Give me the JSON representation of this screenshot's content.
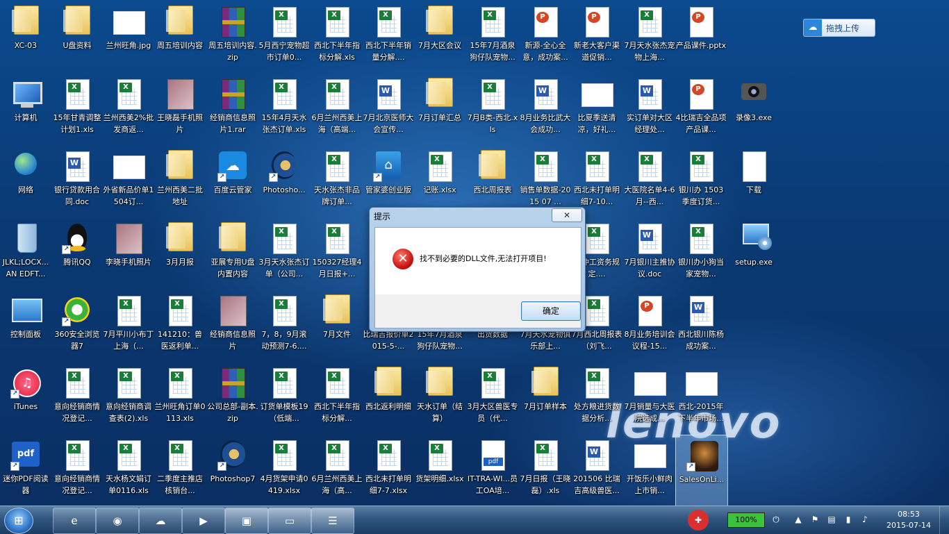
{
  "desktop": {
    "brand_text": "lenovo",
    "icons": [
      {
        "label": "XC-03",
        "icon": "user-folder-icon"
      },
      {
        "label": "U盘资料",
        "icon": "folder-icon"
      },
      {
        "label": "兰州旺角.jpg",
        "icon": "image-file-icon"
      },
      {
        "label": "周五培训内容",
        "icon": "folder-icon"
      },
      {
        "label": "周五培训内容.zip",
        "icon": "rar-archive-icon"
      },
      {
        "label": "5月西宁宠物超市订单0...",
        "icon": "excel-file-icon"
      },
      {
        "label": "西北下半年指标分解.xls",
        "icon": "excel-file-icon"
      },
      {
        "label": "西北下半年销量分解....",
        "icon": "excel-file-icon"
      },
      {
        "label": "7月大区会议",
        "icon": "folder-icon"
      },
      {
        "label": "15年7月酒泉狗仔队宠物...",
        "icon": "excel-file-icon"
      },
      {
        "label": "新源-全心全意，成功案...",
        "icon": "powerpoint-file-icon"
      },
      {
        "label": "新老大客户渠道促销...",
        "icon": "powerpoint-file-icon"
      },
      {
        "label": "7月天水张杰宠物上海...",
        "icon": "excel-file-icon"
      },
      {
        "label": "产品课件.pptx",
        "icon": "powerpoint-file-icon"
      },
      {
        "label": "计算机",
        "icon": "computer-icon"
      },
      {
        "label": "15年甘青调整计划1.xls",
        "icon": "excel-file-icon"
      },
      {
        "label": "兰州西美2%批发商返...",
        "icon": "excel-file-icon"
      },
      {
        "label": "王晓磊手机照片",
        "icon": "photo-folder-icon"
      },
      {
        "label": "经销商信息照片1.rar",
        "icon": "rar-archive-icon"
      },
      {
        "label": "15年4月天水张杰订单.xls",
        "icon": "excel-file-icon"
      },
      {
        "label": "6月兰州西美上海（高端...",
        "icon": "excel-file-icon"
      },
      {
        "label": "7月北京医师大会宣传...",
        "icon": "word-file-icon"
      },
      {
        "label": "7月订单汇总",
        "icon": "folder-icon"
      },
      {
        "label": "7月B类-西北.xls",
        "icon": "excel-file-icon"
      },
      {
        "label": "8月业务比武大会成功...",
        "icon": "word-file-icon"
      },
      {
        "label": "比夏季送清凉，好礼...",
        "icon": "image-file-icon"
      },
      {
        "label": "实订单对大区经理处...",
        "icon": "word-file-icon"
      },
      {
        "label": "4比瑞吉全品项产品课...",
        "icon": "powerpoint-file-icon"
      },
      {
        "label": "录像3.exe",
        "icon": "video-camera-icon"
      },
      {
        "label": "网络",
        "icon": "network-globe-icon"
      },
      {
        "label": "银行贷款用合同.doc",
        "icon": "word-file-icon"
      },
      {
        "label": "外省新品价单1504订...",
        "icon": "image-file-icon"
      },
      {
        "label": "兰州西美二批地址",
        "icon": "folder-icon"
      },
      {
        "label": "百度云管家",
        "icon": "baidu-cloud-icon"
      },
      {
        "label": "Photosho...",
        "icon": "photoshop-icon"
      },
      {
        "label": "天水张杰非品牌订单...",
        "icon": "excel-file-icon"
      },
      {
        "label": "管家婆创业版",
        "icon": "accounting-app-icon"
      },
      {
        "label": "记账.xlsx",
        "icon": "excel-file-icon"
      },
      {
        "label": "西北周报表",
        "icon": "folder-icon"
      },
      {
        "label": "销售单数据-2015 07 ...",
        "icon": "excel-file-icon"
      },
      {
        "label": "西北未打单明细7-10...",
        "icon": "excel-file-icon"
      },
      {
        "label": "大医院名单4-6月--西...",
        "icon": "excel-file-icon"
      },
      {
        "label": "银川办 1503季度订货...",
        "icon": "excel-file-icon"
      },
      {
        "label": "下载",
        "icon": "blank-file-icon"
      },
      {
        "label": "JLKL;LOCX...AN EDFT...",
        "icon": "recycle-bin-icon"
      },
      {
        "label": "腾讯QQ",
        "icon": "qq-penguin-icon"
      },
      {
        "label": "李晓手机照片",
        "icon": "photo-folder-icon"
      },
      {
        "label": "3月月报",
        "icon": "folder-icon"
      },
      {
        "label": "亚展专用U盘内置内容",
        "icon": "folder-icon"
      },
      {
        "label": "3月天水张杰订单（公司...",
        "icon": "excel-file-icon"
      },
      {
        "label": "150327经理4月日报+...",
        "icon": "excel-file-icon"
      },
      {
        "label": "用冲工资务规定....",
        "icon": "excel-file-icon"
      },
      {
        "label": "7月银川主推协议.doc",
        "icon": "word-file-icon"
      },
      {
        "label": "银川办小狗当家宠物...",
        "icon": "excel-file-icon"
      },
      {
        "label": "setup.exe",
        "icon": "setup-disc-icon"
      },
      {
        "label": "控制面板",
        "icon": "control-panel-icon"
      },
      {
        "label": "360安全浏览器7",
        "icon": "browser-360-icon"
      },
      {
        "label": "7月平川小布丁上海（...",
        "icon": "excel-file-icon"
      },
      {
        "label": "141210：兽医返利单...",
        "icon": "excel-file-icon"
      },
      {
        "label": "经销商信息照片",
        "icon": "photo-folder-icon"
      },
      {
        "label": "7，8，9月滚动预测7-6....",
        "icon": "excel-file-icon"
      },
      {
        "label": "7月文件",
        "icon": "folder-icon"
      },
      {
        "label": "比瑞吉报价单2015-5-...",
        "icon": "excel-file-icon"
      },
      {
        "label": "15年7月酒泉狗仔队宠物...",
        "icon": "excel-file-icon"
      },
      {
        "label": "出货数据",
        "icon": "excel-file-icon"
      },
      {
        "label": "7月天水宠物俱乐部上...",
        "icon": "excel-file-icon"
      },
      {
        "label": "7月西北周报表（刘飞...",
        "icon": "excel-file-icon"
      },
      {
        "label": "8月业务培训会议程-15...",
        "icon": "powerpoint-file-icon"
      },
      {
        "label": "西北银川陈杨成功案...",
        "icon": "word-file-icon"
      },
      {
        "label": "iTunes",
        "icon": "itunes-icon"
      },
      {
        "label": "意向经销商情况登记...",
        "icon": "excel-file-icon"
      },
      {
        "label": "意向经销商调查表(2).xls",
        "icon": "excel-file-icon"
      },
      {
        "label": "兰州旺角订单0113.xls",
        "icon": "excel-file-icon"
      },
      {
        "label": "公司总部-副本.zip",
        "icon": "rar-archive-icon"
      },
      {
        "label": "订货单模板19（低端...",
        "icon": "excel-file-icon"
      },
      {
        "label": "西北下半年指标分解...",
        "icon": "excel-file-icon"
      },
      {
        "label": "西北返利明细",
        "icon": "folder-icon"
      },
      {
        "label": "天水订单（结算）",
        "icon": "folder-icon"
      },
      {
        "label": "3月大区兽医专员（代...",
        "icon": "excel-file-icon"
      },
      {
        "label": "7月订单样本",
        "icon": "folder-icon"
      },
      {
        "label": "处方粮进货数据分析...",
        "icon": "excel-file-icon"
      },
      {
        "label": "7月销量与大医院选成...",
        "icon": "image-file-icon"
      },
      {
        "label": "西北-2015年下半年市场...",
        "icon": "image-file-icon"
      },
      {
        "label": "迷你PDF阅读器",
        "icon": "pdf-reader-icon"
      },
      {
        "label": "意向经销商情况登记...",
        "icon": "excel-file-icon"
      },
      {
        "label": "天水杨文娟订单0116.xls",
        "icon": "excel-file-icon"
      },
      {
        "label": "二季度主推店核销台...",
        "icon": "excel-file-icon"
      },
      {
        "label": "Photoshop7",
        "icon": "photoshop-icon"
      },
      {
        "label": "4月货架申请0419.xlsx",
        "icon": "excel-file-icon"
      },
      {
        "label": "6月兰州西美上海（高...",
        "icon": "excel-file-icon"
      },
      {
        "label": "西北未打单明细7-7.xlsx",
        "icon": "excel-file-icon"
      },
      {
        "label": "货架明细.xlsx",
        "icon": "excel-file-icon"
      },
      {
        "label": "IT-TRA-WI...员工OA培...",
        "icon": "pdf-file-icon"
      },
      {
        "label": "7月日报（王晓磊）.xls",
        "icon": "excel-file-icon"
      },
      {
        "label": "201506 比瑞吉高级兽医...",
        "icon": "word-file-icon"
      },
      {
        "label": "开饭乐小鲜肉上市销...",
        "icon": "image-file-icon"
      },
      {
        "label": "SalesOnLi...",
        "icon": "dog-app-icon"
      }
    ]
  },
  "upload_widget": {
    "label": "拖拽上传",
    "icon": "cloud-upload-icon"
  },
  "dialog": {
    "title": "提示",
    "close_label": "✕",
    "message": "找不到必要的DLL文件,无法打开项目!",
    "ok_label": "确定",
    "icon": "error-icon"
  },
  "taskbar": {
    "start_icon": "windows-start-icon",
    "pinned": [
      {
        "name": "ie-browser",
        "icon": "browser-360-icon"
      },
      {
        "name": "photoshop",
        "icon": "photoshop-icon"
      },
      {
        "name": "baidu-cloud",
        "icon": "baidu-cloud-icon"
      },
      {
        "name": "iqiyi",
        "icon": "iqiyi-icon"
      },
      {
        "name": "photo-viewer",
        "icon": "photo-thumbnail-icon"
      },
      {
        "name": "explorer",
        "icon": "folder-icon"
      },
      {
        "name": "app",
        "icon": "app-window-icon"
      }
    ],
    "battery_percent": 100,
    "battery_label": "100%",
    "clock_time": "08:53",
    "clock_date": "2015-07-14"
  }
}
